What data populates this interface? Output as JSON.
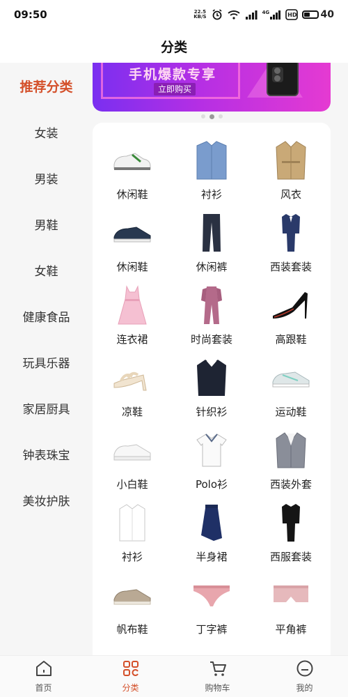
{
  "status_bar": {
    "time": "09:50",
    "net_speed_value": "22.5",
    "net_speed_unit": "KB/S",
    "signal_label": "4G",
    "hd_label": "HD",
    "battery": "40",
    "icons": [
      "alarm-icon",
      "wifi-icon",
      "signal-icon",
      "signal-4g-icon",
      "hd-icon",
      "battery-icon"
    ]
  },
  "header": {
    "title": "分类"
  },
  "sidebar": {
    "items": [
      {
        "label": "推荐分类",
        "active": true
      },
      {
        "label": "女装"
      },
      {
        "label": "男装"
      },
      {
        "label": "男鞋"
      },
      {
        "label": "女鞋"
      },
      {
        "label": "健康食品"
      },
      {
        "label": "玩具乐器"
      },
      {
        "label": "家居厨具"
      },
      {
        "label": "钟表珠宝"
      },
      {
        "label": "美妆护肤"
      }
    ]
  },
  "banner": {
    "title": "手机爆款专享",
    "cta": "立即购买"
  },
  "categories": [
    {
      "label": "休闲鞋",
      "icon": "white-sneaker-icon"
    },
    {
      "label": "衬衫",
      "icon": "blue-shirt-icon"
    },
    {
      "label": "风衣",
      "icon": "trench-coat-icon"
    },
    {
      "label": "休闲鞋",
      "icon": "navy-shoe-icon"
    },
    {
      "label": "休闲裤",
      "icon": "pants-icon"
    },
    {
      "label": "西装套装",
      "icon": "suit-icon"
    },
    {
      "label": "连衣裙",
      "icon": "pink-dress-icon"
    },
    {
      "label": "时尚套装",
      "icon": "jumpsuit-icon"
    },
    {
      "label": "高跟鞋",
      "icon": "high-heel-icon"
    },
    {
      "label": "凉鞋",
      "icon": "sandal-icon"
    },
    {
      "label": "针织衫",
      "icon": "sweater-icon"
    },
    {
      "label": "运动鞋",
      "icon": "sport-shoe-icon"
    },
    {
      "label": "小白鞋",
      "icon": "white-shoe-icon"
    },
    {
      "label": "Polo衫",
      "icon": "polo-shirt-icon"
    },
    {
      "label": "西装外套",
      "icon": "blazer-icon"
    },
    {
      "label": "衬衫",
      "icon": "white-shirt-icon"
    },
    {
      "label": "半身裙",
      "icon": "skirt-icon"
    },
    {
      "label": "西服套装",
      "icon": "black-suit-icon"
    },
    {
      "label": "帆布鞋",
      "icon": "canvas-shoe-icon"
    },
    {
      "label": "丁字裤",
      "icon": "thong-icon"
    },
    {
      "label": "平角裤",
      "icon": "boxer-icon"
    }
  ],
  "bottom_nav": {
    "items": [
      {
        "label": "首页",
        "icon": "home-icon"
      },
      {
        "label": "分类",
        "icon": "category-icon",
        "active": true
      },
      {
        "label": "购物车",
        "icon": "cart-icon"
      },
      {
        "label": "我的",
        "icon": "profile-icon"
      }
    ]
  },
  "colors": {
    "accent": "#d4502a",
    "sidebar_bg": "#f6f6f6",
    "banner_start": "#7a2ff0",
    "banner_end": "#e53ad2"
  }
}
